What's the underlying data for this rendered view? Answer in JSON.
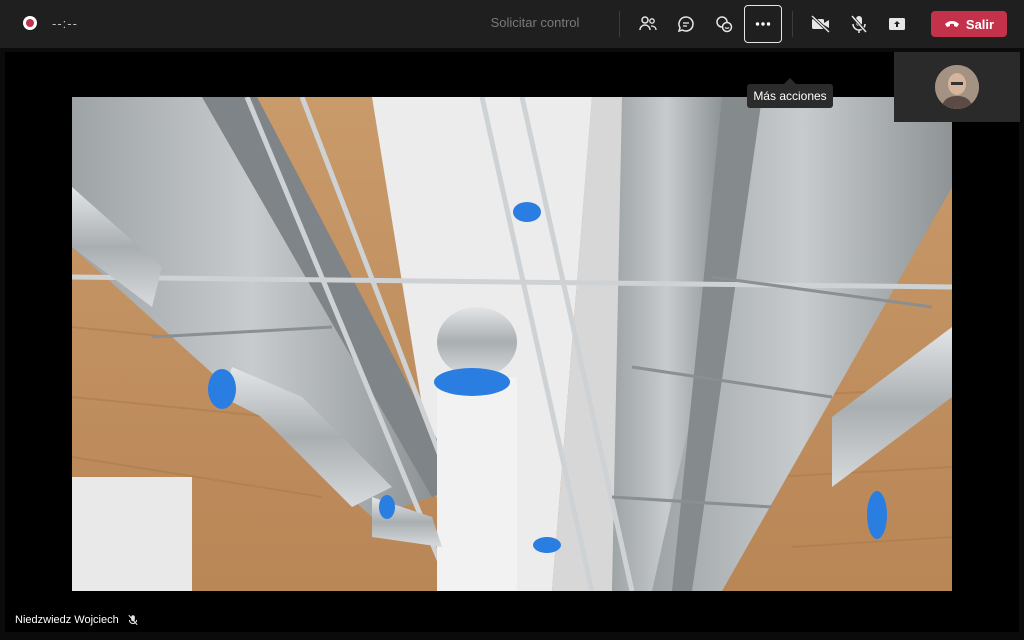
{
  "toolbar": {
    "timer": "--:--",
    "request_control": "Solicitar control",
    "leave_label": "Salir",
    "more_actions_tooltip": "Más acciones",
    "icons": {
      "record": "record-indicator-icon",
      "people": "people-icon",
      "chat": "chat-icon",
      "reactions": "reactions-icon",
      "more": "more-actions-icon",
      "camera": "camera-off-icon",
      "mic": "mic-off-icon",
      "share": "share-screen-icon",
      "phone": "phone-hangup-icon"
    }
  },
  "participant": {
    "name": "Niedzwiedz Wojciech",
    "muted": true
  },
  "colors": {
    "leave": "#c4314b",
    "topbar": "#1f1f1f",
    "background": "#000000"
  }
}
